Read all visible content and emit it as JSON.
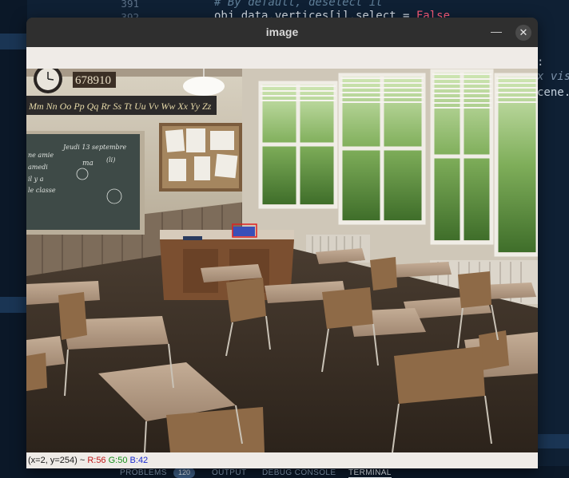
{
  "editor": {
    "line_numbers": [
      "391",
      "392"
    ],
    "comment_text": "# By default, deselect it",
    "code_line_prefix": "obj_data.vertices[i].select = ",
    "code_line_keyword": "False",
    "right_fragments": [
      ":",
      "x vis",
      "cene."
    ],
    "panel_tabs": [
      "PROBLEMS",
      "OUTPUT",
      "DEBUG CONSOLE",
      "TERMINAL"
    ],
    "problems_count": "120"
  },
  "window": {
    "title": "image",
    "minimize_icon": "minimize-icon",
    "close_icon": "close-icon"
  },
  "scene": {
    "alphabet_strip": "Mm Nn Oo Pp Qq Rr Ss Tt Uu Vv Ww Xx Yy Zz",
    "clock_digits": "678910",
    "chalkboard_lines": [
      "Jeudi 13 septembre",
      "ne amie",
      "amedi",
      "il y a",
      "le classe"
    ],
    "chalkboard_marks": [
      "ma",
      "(li)"
    ]
  },
  "status": {
    "coords": "(x=2, y=254) ~",
    "r": "R:56",
    "g": "G:50",
    "b": "B:42"
  }
}
